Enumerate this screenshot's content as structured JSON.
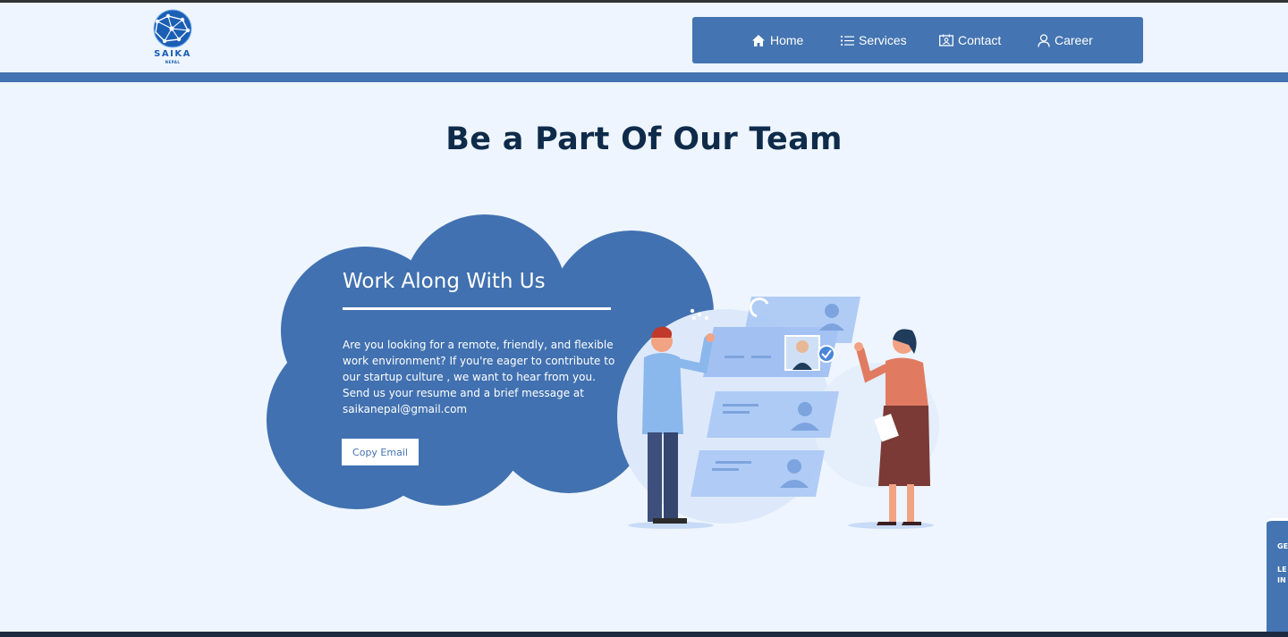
{
  "brand": {
    "name": "SAIKA",
    "sub": "NEPAL"
  },
  "nav": {
    "items": [
      {
        "label": "Home",
        "icon": "home-icon"
      },
      {
        "label": "Services",
        "icon": "list-icon"
      },
      {
        "label": "Contact",
        "icon": "contact-card-icon"
      },
      {
        "label": "Career",
        "icon": "user-icon"
      }
    ]
  },
  "page": {
    "title": "Be a Part Of Our Team"
  },
  "card": {
    "title": "Work Along With Us",
    "body": "Are you looking for a remote, friendly, and flexible work environment? If you're eager to contribute to our startup culture , we want to hear from you. Send us your resume and a brief message at saikanepal@gmail.com",
    "button": "Copy Email"
  },
  "side_widget": {
    "line1": "GE",
    "line2": "LE",
    "line3": "IN"
  },
  "colors": {
    "accent": "#4474b1",
    "background": "#eef5fe",
    "title": "#0f2b4a",
    "footer": "#1d2a3f"
  }
}
